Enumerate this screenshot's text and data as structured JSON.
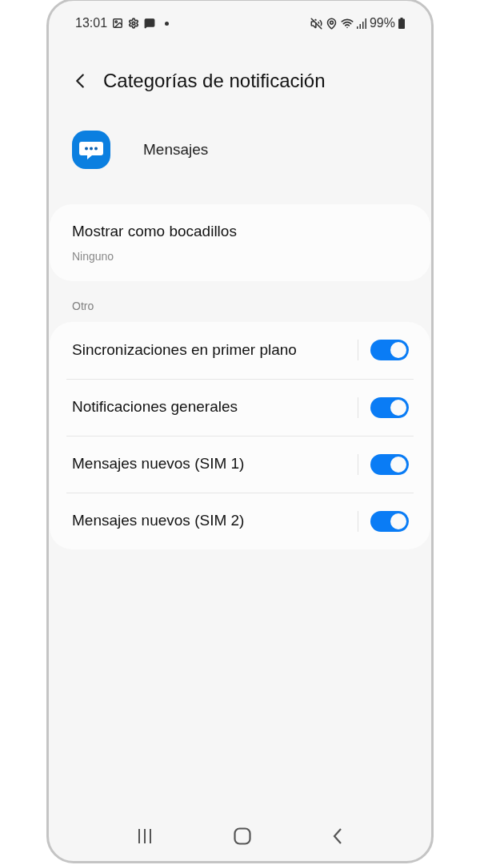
{
  "status_bar": {
    "time": "13:01",
    "battery": "99%"
  },
  "header": {
    "title": "Categorías de notificación"
  },
  "app": {
    "name": "Mensajes"
  },
  "bubbles": {
    "title": "Mostrar como bocadillos",
    "value": "Ninguno"
  },
  "section": {
    "title": "Otro"
  },
  "categories": [
    {
      "label": "Sincronizaciones en primer plano",
      "on": true
    },
    {
      "label": "Notificaciones generales",
      "on": true
    },
    {
      "label": "Mensajes nuevos (SIM 1)",
      "on": true
    },
    {
      "label": "Mensajes nuevos (SIM 2)",
      "on": true
    }
  ]
}
